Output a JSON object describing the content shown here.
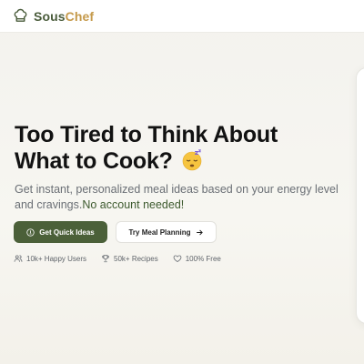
{
  "brand": {
    "part1": "Sous",
    "part2": "Chef",
    "icon": "chef-hat-icon",
    "primary_color": "#4a5c3b",
    "accent_color": "#c59a4b"
  },
  "hero": {
    "title_line1": "Too Tired to Think About",
    "title_line2": "What to Cook?",
    "title_emoji": "sleeping-face-emoji",
    "subtitle": "Get instant, personalized meal ideas based on your energy level and cravings.",
    "subtitle_highlight": "No account needed!"
  },
  "actions": {
    "primary_label": "Get Quick Ideas",
    "primary_icon": "lightbulb-icon",
    "secondary_label": "Try Meal Planning",
    "secondary_icon": "arrow-right-icon"
  },
  "stats": [
    {
      "icon": "users-icon",
      "label": "10k+ Happy Users"
    },
    {
      "icon": "trophy-icon",
      "label": "50k+ Recipes"
    },
    {
      "icon": "heart-icon",
      "label": "100% Free"
    }
  ]
}
